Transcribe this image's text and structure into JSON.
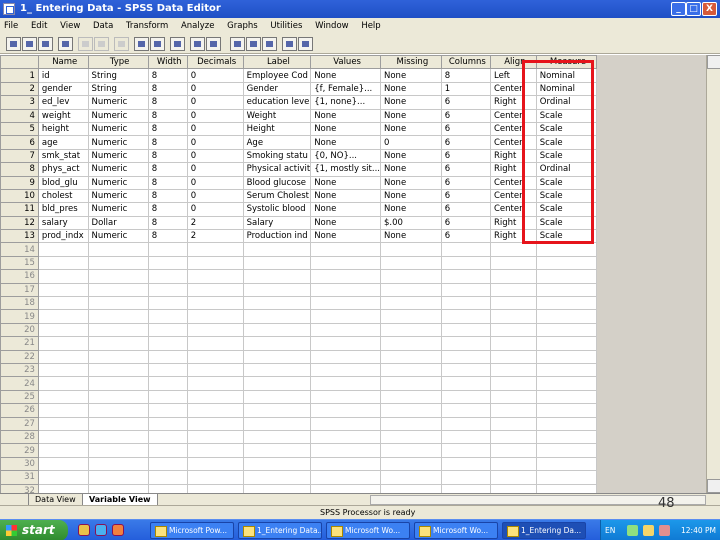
{
  "window": {
    "title": "1_ Entering Data - SPSS Data Editor",
    "minimize_label": "_",
    "maximize_label": "□",
    "close_label": "X"
  },
  "menu": [
    "File",
    "Edit",
    "View",
    "Data",
    "Transform",
    "Analyze",
    "Graphs",
    "Utilities",
    "Window",
    "Help"
  ],
  "columns": [
    "Name",
    "Type",
    "Width",
    "Decimals",
    "Label",
    "Values",
    "Missing",
    "Columns",
    "Align",
    "Measure"
  ],
  "rows": [
    {
      "num": "1",
      "cells": [
        "id",
        "String",
        "8",
        "0",
        "Employee Cod",
        "None",
        "None",
        "8",
        "Left",
        "Nominal"
      ]
    },
    {
      "num": "2",
      "cells": [
        "gender",
        "String",
        "8",
        "0",
        "Gender",
        "{f, Female}...",
        "None",
        "1",
        "Center",
        "Nominal"
      ]
    },
    {
      "num": "3",
      "cells": [
        "ed_lev",
        "Numeric",
        "8",
        "0",
        "education leve",
        "{1, none}...",
        "None",
        "6",
        "Right",
        "Ordinal"
      ]
    },
    {
      "num": "4",
      "cells": [
        "weight",
        "Numeric",
        "8",
        "0",
        "Weight",
        "None",
        "None",
        "6",
        "Center",
        "Scale"
      ]
    },
    {
      "num": "5",
      "cells": [
        "height",
        "Numeric",
        "8",
        "0",
        "Height",
        "None",
        "None",
        "6",
        "Center",
        "Scale"
      ]
    },
    {
      "num": "6",
      "cells": [
        "age",
        "Numeric",
        "8",
        "0",
        "Age",
        "None",
        "0",
        "6",
        "Center",
        "Scale"
      ]
    },
    {
      "num": "7",
      "cells": [
        "smk_stat",
        "Numeric",
        "8",
        "0",
        "Smoking statu",
        "{0, NO}...",
        "None",
        "6",
        "Right",
        "Scale"
      ]
    },
    {
      "num": "8",
      "cells": [
        "phys_act",
        "Numeric",
        "8",
        "0",
        "Physical activit",
        "{1, mostly sit...",
        "None",
        "6",
        "Right",
        "Ordinal"
      ]
    },
    {
      "num": "9",
      "cells": [
        "blod_glu",
        "Numeric",
        "8",
        "0",
        "Blood glucose",
        "None",
        "None",
        "6",
        "Center",
        "Scale"
      ]
    },
    {
      "num": "10",
      "cells": [
        "cholest",
        "Numeric",
        "8",
        "0",
        "Serum Cholest",
        "None",
        "None",
        "6",
        "Center",
        "Scale"
      ]
    },
    {
      "num": "11",
      "cells": [
        "bld_pres",
        "Numeric",
        "8",
        "0",
        "Systolic blood",
        "None",
        "None",
        "6",
        "Center",
        "Scale"
      ]
    },
    {
      "num": "12",
      "cells": [
        "salary",
        "Dollar",
        "8",
        "2",
        "Salary",
        "None",
        "$.00",
        "6",
        "Right",
        "Scale"
      ]
    },
    {
      "num": "13",
      "cells": [
        "prod_indx",
        "Numeric",
        "8",
        "2",
        "Production ind",
        "None",
        "None",
        "6",
        "Right",
        "Scale"
      ]
    }
  ],
  "empty_rows": [
    "14",
    "15",
    "16",
    "17",
    "18",
    "19",
    "20",
    "21",
    "22",
    "23",
    "24",
    "25",
    "26",
    "27",
    "28",
    "29",
    "30",
    "31",
    "32"
  ],
  "tabs": {
    "data_view": "Data View",
    "variable_view": "Variable View"
  },
  "status_text": "SPSS Processor is ready",
  "page_number": "48",
  "taskbar": {
    "start_label": "start",
    "tasks": [
      "Microsoft Pow...",
      "1_Entering Data...",
      "Microsoft Wo...",
      "Microsoft Wo...",
      "1_Entering Da..."
    ],
    "tray_lang": "EN",
    "clock": "12:40 PM"
  },
  "colors": {
    "highlight_box": "#e6141b",
    "title_bar": "#2f62d9",
    "taskbar": "#245edb"
  }
}
